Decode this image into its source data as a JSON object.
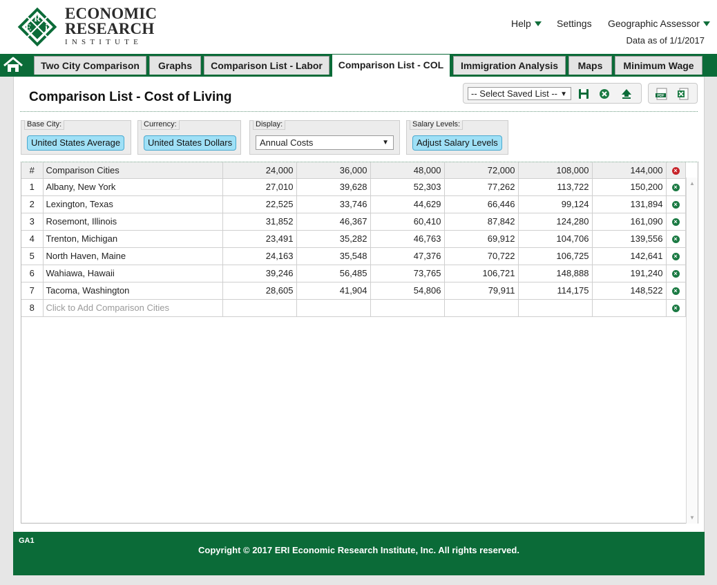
{
  "brand": {
    "logo_line1": "ECONOMIC",
    "logo_line2": "RESEARCH",
    "logo_line3": "INSTITUTE",
    "emblem_letters": [
      "E",
      "R",
      "i"
    ]
  },
  "header": {
    "help": "Help",
    "settings": "Settings",
    "product": "Geographic Assessor",
    "data_as_of": "Data as of 1/1/2017"
  },
  "tabs": [
    {
      "label": "Two City Comparison",
      "active": false
    },
    {
      "label": "Graphs",
      "active": false
    },
    {
      "label": "Comparison List - Labor",
      "active": false
    },
    {
      "label": "Comparison List - COL",
      "active": true
    },
    {
      "label": "Immigration Analysis",
      "active": false
    },
    {
      "label": "Maps",
      "active": false
    },
    {
      "label": "Minimum Wage",
      "active": false
    }
  ],
  "page": {
    "title": "Comparison List - Cost of Living",
    "saved_list_placeholder": "-- Select Saved List --"
  },
  "filters": {
    "base_city_label": "Base City:",
    "base_city_value": "United States Average",
    "currency_label": "Currency:",
    "currency_value": "United States Dollars",
    "display_label": "Display:",
    "display_value": "Annual Costs",
    "salary_label": "Salary Levels:",
    "salary_button": "Adjust Salary Levels"
  },
  "grid": {
    "header": {
      "idx": "#",
      "city": "Comparison Cities",
      "levels": [
        "24,000",
        "36,000",
        "48,000",
        "72,000",
        "108,000",
        "144,000"
      ]
    },
    "rows": [
      {
        "idx": "1",
        "city": "Albany, New York",
        "values": [
          "27,010",
          "39,628",
          "52,303",
          "77,262",
          "113,722",
          "150,200"
        ]
      },
      {
        "idx": "2",
        "city": "Lexington, Texas",
        "values": [
          "22,525",
          "33,746",
          "44,629",
          "66,446",
          "99,124",
          "131,894"
        ]
      },
      {
        "idx": "3",
        "city": "Rosemont, Illinois",
        "values": [
          "31,852",
          "46,367",
          "60,410",
          "87,842",
          "124,280",
          "161,090"
        ]
      },
      {
        "idx": "4",
        "city": "Trenton, Michigan",
        "values": [
          "23,491",
          "35,282",
          "46,763",
          "69,912",
          "104,706",
          "139,556"
        ]
      },
      {
        "idx": "5",
        "city": "North Haven, Maine",
        "values": [
          "24,163",
          "35,548",
          "47,376",
          "70,722",
          "106,725",
          "142,641"
        ]
      },
      {
        "idx": "6",
        "city": "Wahiawa, Hawaii",
        "values": [
          "39,246",
          "56,485",
          "73,765",
          "106,721",
          "148,888",
          "191,240"
        ]
      },
      {
        "idx": "7",
        "city": "Tacoma, Washington",
        "values": [
          "28,605",
          "41,904",
          "54,806",
          "79,911",
          "114,175",
          "148,522"
        ]
      }
    ],
    "add_row": {
      "idx": "8",
      "placeholder": "Click to Add Comparison Cities"
    }
  },
  "footer": {
    "code": "GA1",
    "copyright": "Copyright © 2017 ERI Economic Research Institute, Inc. All rights reserved."
  },
  "colors": {
    "brand_green": "#0b6b38",
    "pill_blue": "#9fe0f6",
    "remove_red": "#c7242a"
  }
}
